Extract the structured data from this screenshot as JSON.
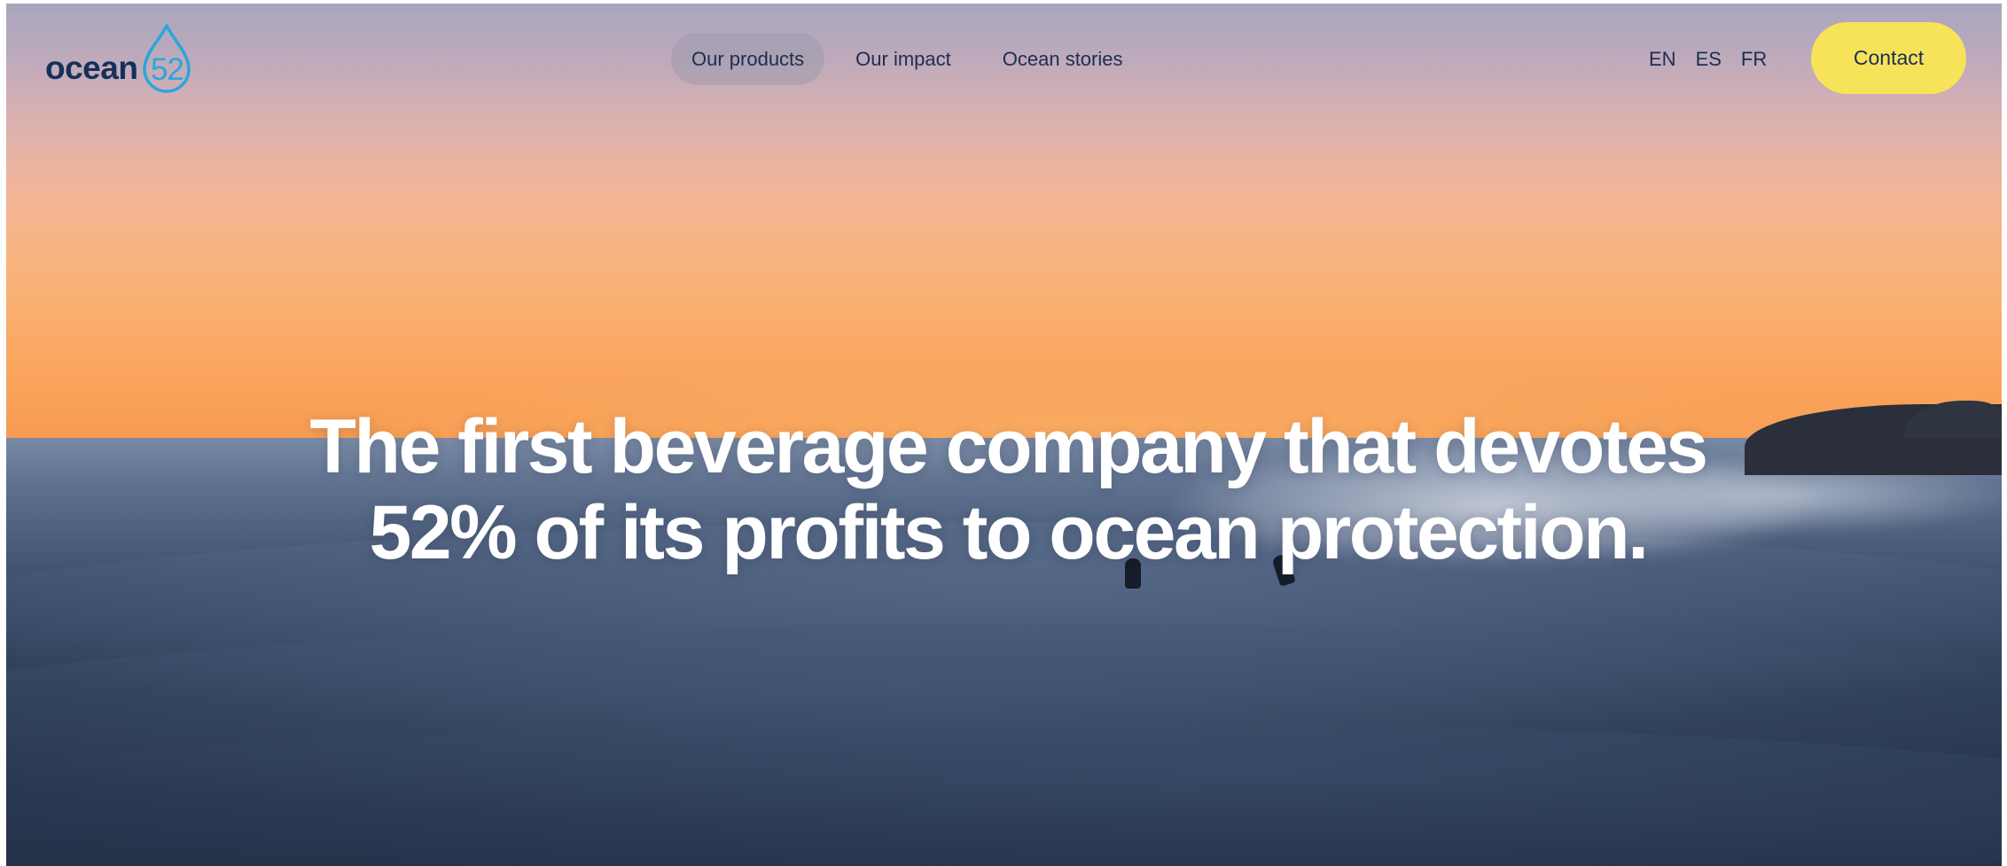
{
  "brand": {
    "word": "ocean",
    "number": "52",
    "colors": {
      "navy": "#16305a",
      "drop": "#2aa6db"
    }
  },
  "nav": {
    "items": [
      {
        "label": "Our products",
        "active": true
      },
      {
        "label": "Our impact",
        "active": false
      },
      {
        "label": "Ocean stories",
        "active": false
      }
    ]
  },
  "languages": [
    "EN",
    "ES",
    "FR"
  ],
  "contact": {
    "label": "Contact",
    "color": "#f7e35a"
  },
  "hero": {
    "headline_line1": "The first beverage company that devotes",
    "headline_line2": "52% of its profits to ocean protection.",
    "background": "sunset-ocean-wave-surfers-image"
  }
}
